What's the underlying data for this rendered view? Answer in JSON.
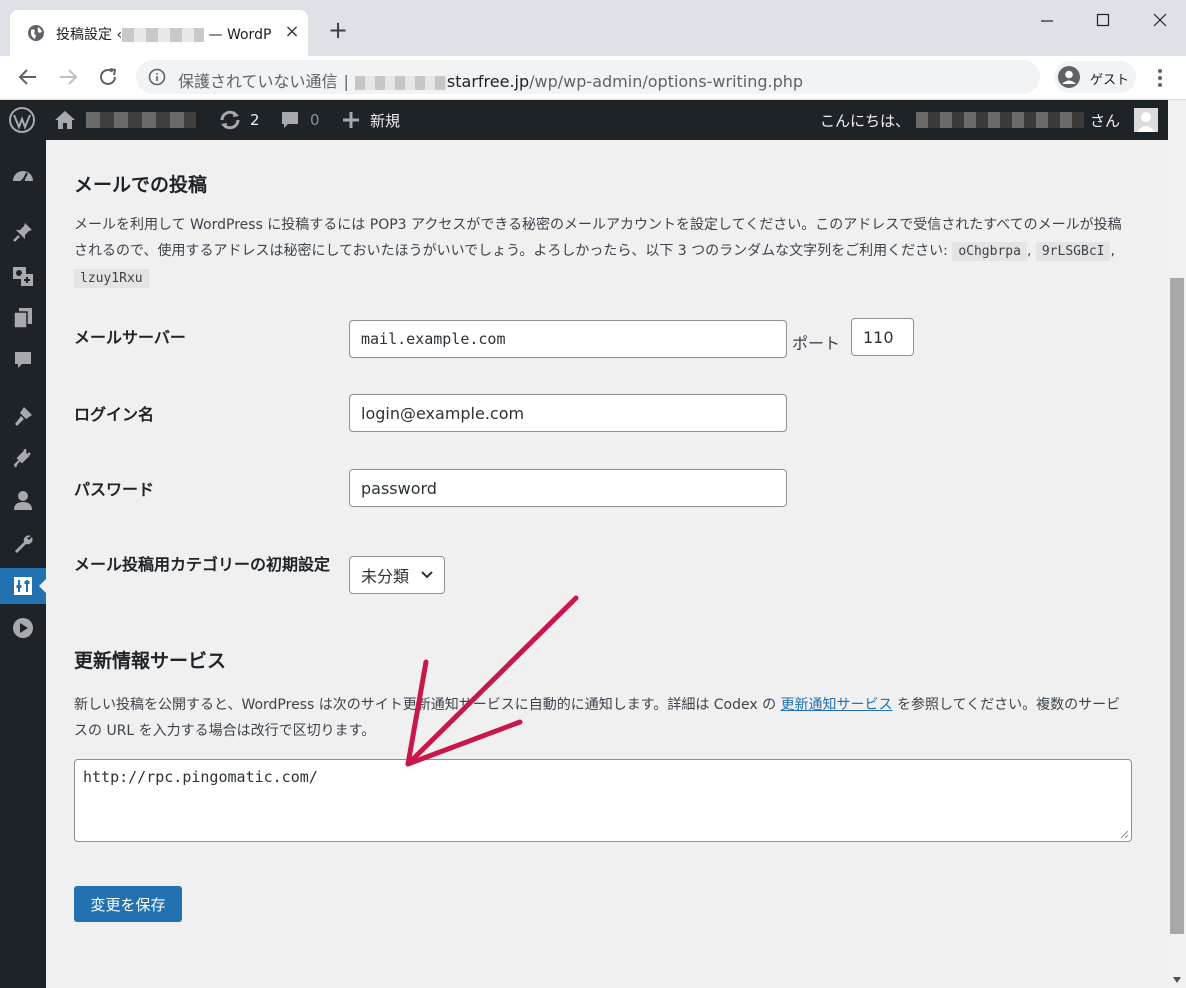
{
  "browser": {
    "tab_title_prefix": "投稿設定 ‹",
    "tab_title_suffix": "— WordP",
    "tab_close": "×",
    "new_tab": "+",
    "url_warning": "保護されていない通信",
    "url_separator": "|",
    "url_domain": "starfree.jp",
    "url_path": "/wp/wp-admin/options-writing.php",
    "profile_label": "ゲスト"
  },
  "adminbar": {
    "updates_count": "2",
    "comments_count": "0",
    "new_label": "新規",
    "greeting_prefix": "こんにちは、",
    "greeting_suffix": "さん"
  },
  "post_via_email": {
    "heading": "メールでの投稿",
    "description": "メールを利用して WordPress に投稿するには POP3 アクセスができる秘密のメールアカウントを設定してください。このアドレスで受信されたすべてのメールが投稿されるので、使用するアドレスは秘密にしておいたほうがいいでしょう。よろしかったら、以下 3 つのランダムな文字列をご利用ください:",
    "random_strings": [
      "oChgbrpa",
      "9rLSGBcI",
      "lzuy1Rxu"
    ],
    "separator": ",",
    "mail_server_label": "メールサーバー",
    "mail_server_value": "mail.example.com",
    "port_label": "ポート",
    "port_value": "110",
    "login_label": "ログイン名",
    "login_value": "login@example.com",
    "password_label": "パスワード",
    "password_value": "password",
    "category_label": "メール投稿用カテゴリーの初期設定",
    "category_value": "未分類"
  },
  "update_services": {
    "heading": "更新情報サービス",
    "description_before": "新しい投稿を公開すると、WordPress は次のサイト更新通知サービスに自動的に通知します。詳細は Codex の ",
    "link_text": "更新通知サービス",
    "description_after": " を参照してください。複数のサービスの URL を入力する場合は改行で区切ります。",
    "ping_sites": "http://rpc.pingomatic.com/"
  },
  "save_button": "変更を保存",
  "colors": {
    "admin_dark": "#1d2327",
    "accent_blue": "#2271b1",
    "annotation_arrow": "#c8174b",
    "content_bg": "#f0f0f1"
  },
  "icons": {
    "sidebar": [
      "dashboard-icon",
      "pin-icon",
      "media-icon",
      "pages-icon",
      "comments-icon",
      "appearance-icon",
      "plugins-icon",
      "users-icon",
      "tools-icon",
      "settings-icon",
      "play-icon"
    ]
  }
}
